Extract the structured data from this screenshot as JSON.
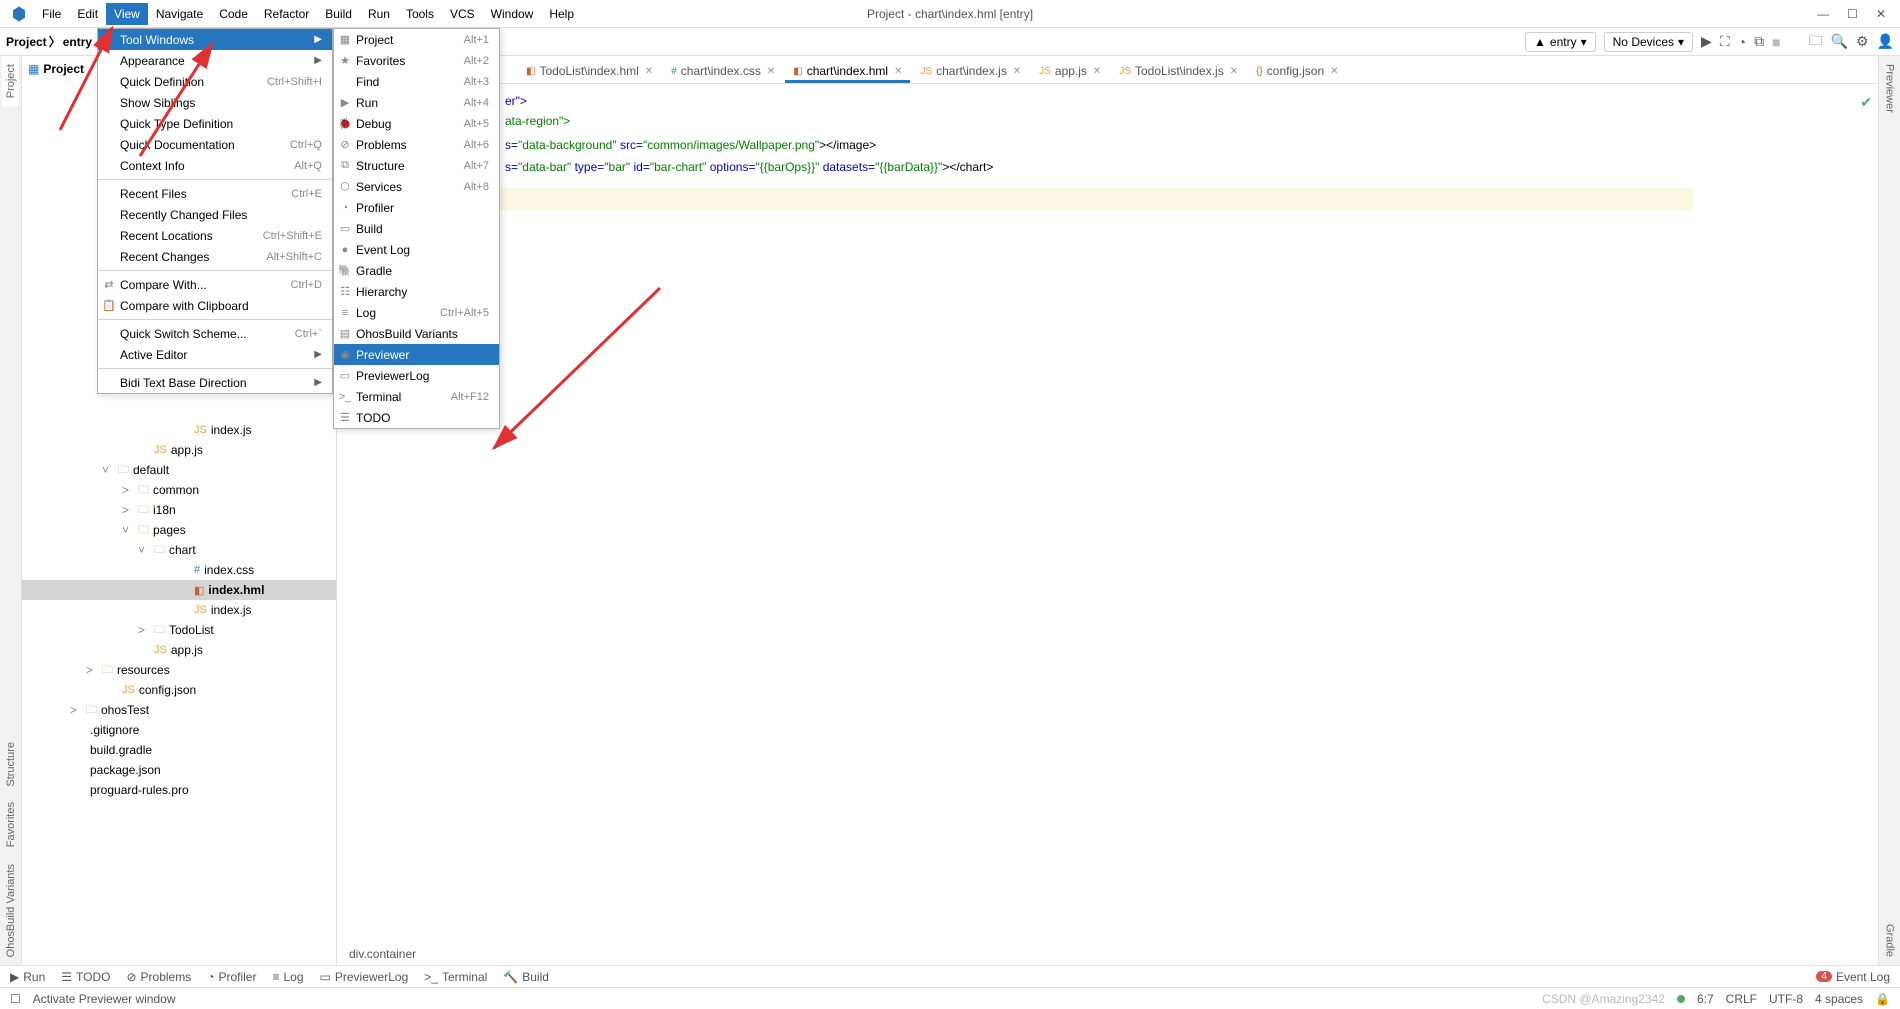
{
  "window": {
    "title": "Project - chart\\index.hml [entry]"
  },
  "menubar": [
    "File",
    "Edit",
    "View",
    "Navigate",
    "Code",
    "Refactor",
    "Build",
    "Run",
    "Tools",
    "VCS",
    "Window",
    "Help"
  ],
  "breadcrumb": [
    "Project",
    "entry"
  ],
  "topright": {
    "config": "entry",
    "devices": "No Devices"
  },
  "viewMenu": [
    {
      "label": "Tool Windows",
      "sub": true,
      "sel": true
    },
    {
      "label": "Appearance",
      "sub": true
    },
    {
      "label": "Quick Definition",
      "sc": "Ctrl+Shift+I"
    },
    {
      "label": "Show Siblings"
    },
    {
      "label": "Quick Type Definition"
    },
    {
      "label": "Quick Documentation",
      "sc": "Ctrl+Q"
    },
    {
      "label": "Context Info",
      "sc": "Alt+Q"
    },
    {
      "sep": true
    },
    {
      "label": "Recent Files",
      "sc": "Ctrl+E"
    },
    {
      "label": "Recently Changed Files"
    },
    {
      "label": "Recent Locations",
      "sc": "Ctrl+Shift+E"
    },
    {
      "label": "Recent Changes",
      "sc": "Alt+Shift+C"
    },
    {
      "sep": true
    },
    {
      "label": "Compare With...",
      "sc": "Ctrl+D",
      "pic": "⇄"
    },
    {
      "label": "Compare with Clipboard",
      "pic": "📋"
    },
    {
      "sep": true
    },
    {
      "label": "Quick Switch Scheme...",
      "sc": "Ctrl+`"
    },
    {
      "label": "Active Editor",
      "sub": true
    },
    {
      "sep": true
    },
    {
      "label": "Bidi Text Base Direction",
      "sub": true
    }
  ],
  "toolMenu": [
    {
      "label": "Project",
      "sc": "Alt+1",
      "pic": "▦"
    },
    {
      "label": "Favorites",
      "sc": "Alt+2",
      "pic": "★"
    },
    {
      "label": "Find",
      "sc": "Alt+3"
    },
    {
      "label": "Run",
      "sc": "Alt+4",
      "pic": "▶"
    },
    {
      "label": "Debug",
      "sc": "Alt+5",
      "pic": "🐞"
    },
    {
      "label": "Problems",
      "sc": "Alt+6",
      "pic": "⊘"
    },
    {
      "label": "Structure",
      "sc": "Alt+7",
      "pic": "⧉"
    },
    {
      "label": "Services",
      "sc": "Alt+8",
      "pic": "⬡"
    },
    {
      "label": "Profiler",
      "pic": "◔"
    },
    {
      "label": "Build",
      "pic": "▭"
    },
    {
      "label": "Event Log",
      "pic": "●"
    },
    {
      "label": "Gradle",
      "pic": "🐘"
    },
    {
      "label": "Hierarchy",
      "pic": "☷"
    },
    {
      "label": "Log",
      "sc": "Ctrl+Alt+5",
      "pic": "≡"
    },
    {
      "label": "OhosBuild Variants",
      "pic": "▤"
    },
    {
      "label": "Previewer",
      "sel": true,
      "pic": "◉"
    },
    {
      "label": "PreviewerLog",
      "pic": "▭"
    },
    {
      "label": "Terminal",
      "sc": "Alt+F12",
      "pic": ">_"
    },
    {
      "label": "TODO",
      "pic": "☰"
    }
  ],
  "tabs": [
    {
      "label": "TodoList\\index.hml"
    },
    {
      "label": "chart\\index.css"
    },
    {
      "label": "chart\\index.hml",
      "active": true
    },
    {
      "label": "chart\\index.js"
    },
    {
      "label": "app.js"
    },
    {
      "label": "TodoList\\index.js"
    },
    {
      "label": "config.json"
    }
  ],
  "leftTabs": [
    "Project",
    "Structure",
    "Favorites",
    "OhosBuild Variants"
  ],
  "rightTabs": [
    "Previewer",
    "Gradle"
  ],
  "projTree": [
    {
      "pad": 156,
      "ic": "jsic",
      "txt": "index.js"
    },
    {
      "pad": 116,
      "ic": "jsic",
      "txt": "app.js"
    },
    {
      "pad": 80,
      "chev": "˅",
      "ic": "folder",
      "txt": "default"
    },
    {
      "pad": 100,
      "chev": ">",
      "ic": "folder",
      "txt": "common"
    },
    {
      "pad": 100,
      "chev": ">",
      "ic": "folder",
      "txt": "i18n"
    },
    {
      "pad": 100,
      "chev": "˅",
      "ic": "folder",
      "txt": "pages"
    },
    {
      "pad": 116,
      "chev": "˅",
      "ic": "folder",
      "txt": "chart"
    },
    {
      "pad": 156,
      "ic": "cssic",
      "txt": "index.css"
    },
    {
      "pad": 156,
      "ic": "hmlic",
      "txt": "index.hml",
      "sel": true,
      "bold": true
    },
    {
      "pad": 156,
      "ic": "jsic",
      "txt": "index.js"
    },
    {
      "pad": 116,
      "chev": ">",
      "ic": "folder",
      "txt": "TodoList"
    },
    {
      "pad": 116,
      "ic": "jsic",
      "txt": "app.js"
    },
    {
      "pad": 64,
      "chev": ">",
      "ic": "folder",
      "txt": "resources"
    },
    {
      "pad": 84,
      "ic": "jsic",
      "txt": "config.json"
    },
    {
      "pad": 48,
      "chev": ">",
      "ic": "folder",
      "txt": "ohosTest"
    },
    {
      "pad": 48,
      "ic": "",
      "txt": ".gitignore"
    },
    {
      "pad": 48,
      "ic": "",
      "txt": "build.gradle"
    },
    {
      "pad": 48,
      "ic": "",
      "txt": "package.json"
    },
    {
      "pad": 48,
      "ic": "",
      "txt": "proguard-rules.pro"
    }
  ],
  "code": {
    "l1": "er\">",
    "l2a": "ata-region\">",
    "l3a": "s=\"data-background\" src=\"common/images/Wallpaper.png\"></image>",
    "l4a": "s=\"data-bar\" type=\"bar\" id=\"bar-chart\" options=\"{{barOps}}\" datasets=\"{{barData}}\"></chart>",
    "path": "div.container"
  },
  "bottomBar": {
    "items": [
      "Run",
      "TODO",
      "Problems",
      "Profiler",
      "Log",
      "PreviewerLog",
      "Terminal",
      "Build"
    ],
    "eventLog": "Event Log",
    "eventCount": "4"
  },
  "status": {
    "msg": "Activate Previewer window",
    "pos": "6:7",
    "eol": "CRLF",
    "enc": "UTF-8",
    "indent": "4 spaces",
    "watermark": "CSDN @Amazing2342"
  }
}
